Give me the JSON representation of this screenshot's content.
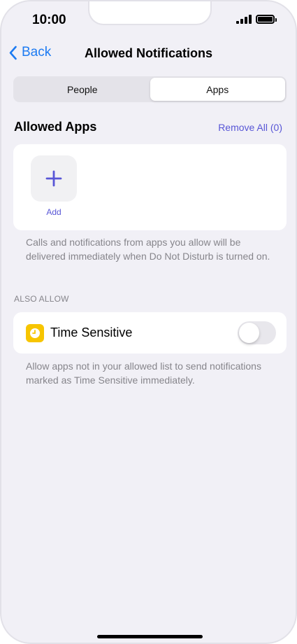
{
  "status_bar": {
    "time": "10:00"
  },
  "nav": {
    "back_label": "Back",
    "title": "Allowed Notifications"
  },
  "segmented": {
    "options": [
      "People",
      "Apps"
    ],
    "selected": "Apps"
  },
  "allowed_apps": {
    "title": "Allowed Apps",
    "remove_all": "Remove All (0)",
    "add_label": "Add",
    "footer": "Calls and notifications from apps you allow will be delivered immediately when Do Not Disturb is turned on."
  },
  "also_allow": {
    "header": "ALSO ALLOW",
    "time_sensitive": {
      "label": "Time Sensitive",
      "enabled": false,
      "footer": "Allow apps not in your allowed list to send notifications marked as Time Sensitive immediately."
    }
  },
  "colors": {
    "accent_blue": "#1d7bf2",
    "accent_purple": "#5856d6",
    "time_sensitive_icon": "#f7c500",
    "background": "#f1f0f6"
  },
  "icons": {
    "back": "chevron-left-icon",
    "add": "plus-icon",
    "time_sensitive": "clock-icon"
  }
}
